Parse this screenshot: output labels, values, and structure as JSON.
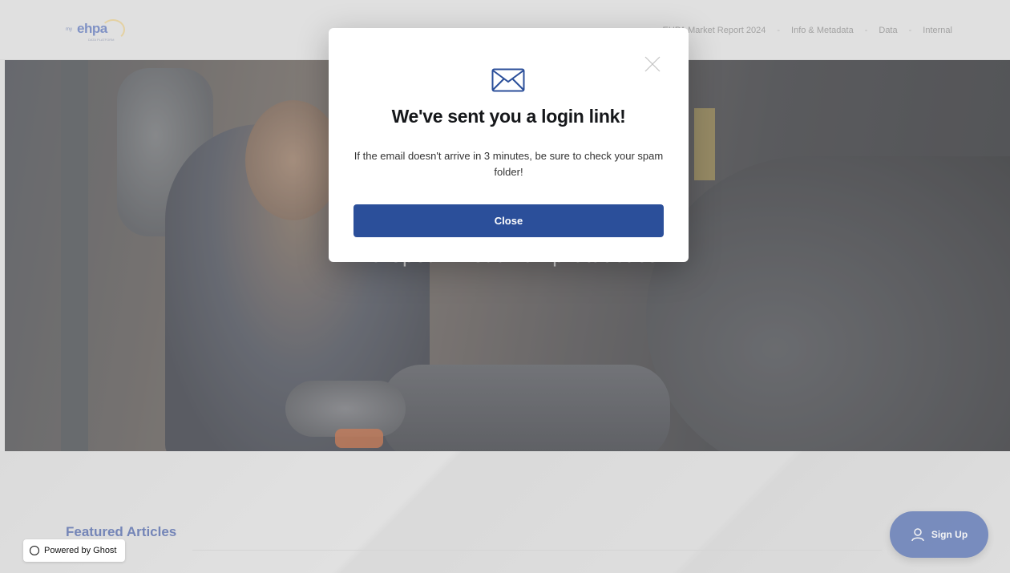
{
  "header": {
    "logo": {
      "prefix": "my",
      "brand": "ehpa",
      "tagline": "DATA PLATFORM"
    },
    "nav_items": [
      {
        "label": "EHPA Market Report 2024"
      },
      {
        "label": "Info & Metadata"
      },
      {
        "label": "Data"
      },
      {
        "label": "Internal"
      }
    ]
  },
  "hero": {
    "title": "European Heat Pump Statistics"
  },
  "featured": {
    "heading": "Featured Articles"
  },
  "powered_by": {
    "label": "Powered by Ghost"
  },
  "signup": {
    "label": "Sign Up"
  },
  "modal": {
    "title": "We've sent you a login link!",
    "message": "If the email doesn't arrive in 3 minutes, be sure to check your spam folder!",
    "button_label": "Close",
    "accent_color": "#2b4f9a"
  },
  "icons": {
    "envelope": "envelope-icon",
    "close": "close-icon",
    "user": "user-icon",
    "ghost": "ghost-icon"
  }
}
